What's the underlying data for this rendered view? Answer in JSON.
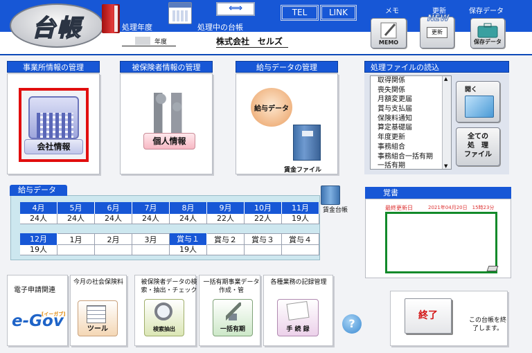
{
  "header": {
    "logo": "台帳",
    "fiscal_year_label": "処理年度",
    "current_book_label": "処理中の台帳",
    "arrows": "⟺",
    "tel": "TEL",
    "link": "LINK",
    "memo_label": "メモ",
    "update_label": "更新",
    "save_label": "保存データ",
    "memo_btn": "MEMO",
    "update_btn": "更新",
    "update_new": "NEW",
    "save_btn": "保存データ",
    "fiscal_year_suffix": "年度",
    "company_name": "株式会社　セルズ"
  },
  "office": {
    "title": "事業所情報の管理",
    "button": "会社情報"
  },
  "insured": {
    "title": "被保険者情報の管理",
    "button": "個人情報"
  },
  "payroll": {
    "title": "給与データの管理",
    "button": "給与データ",
    "ledger_file": "賃金ファイル"
  },
  "files": {
    "title": "処理ファイルの読込",
    "items": [
      "取得関係",
      "喪失関係",
      "月額変更届",
      "賞与支払届",
      "保険料通知",
      "算定基礎届",
      "年度更新",
      "事務組合",
      "事務組合一括有期",
      "一括有期"
    ],
    "open": "開く",
    "all_files": [
      "全ての",
      "処　理",
      "ファイル"
    ]
  },
  "payroll_data": {
    "tab": "給与データ",
    "ledger": "賃金台帳",
    "row1_headers": [
      "4月",
      "5月",
      "6月",
      "7月",
      "8月",
      "9月",
      "10月",
      "11月"
    ],
    "row1_values": [
      "24人",
      "24人",
      "24人",
      "24人",
      "24人",
      "22人",
      "22人",
      "19人"
    ],
    "row2_headers": [
      "12月",
      "1月",
      "2月",
      "3月",
      "賞与１",
      "賞与２",
      "賞与３",
      "賞与４"
    ],
    "row2_values": [
      "19人",
      "",
      "",
      "",
      "19人",
      "",
      "",
      ""
    ]
  },
  "memo": {
    "title": "覚書",
    "last_updated_label": "最終更新日",
    "last_updated_value": "2021年04月20日　15時23分"
  },
  "bottom": {
    "egov_title": "電子申請関連",
    "egov_logo": "e-Gov",
    "egov_sub": "[イーガブ]",
    "social_title": "今月の社会保険料",
    "tool": "ツール",
    "search_title": "被保険者データの検索・抽出・チェック",
    "search_btn": "検索抽出",
    "bulk_title": "一括有期事業データ作成・管",
    "bulk_btn": "一括有期",
    "record_title": "各種業務の記録管理",
    "record_btn": "手 続 録",
    "help": "?",
    "end_btn": "終了",
    "end_note": "この台帳を終了します。"
  }
}
